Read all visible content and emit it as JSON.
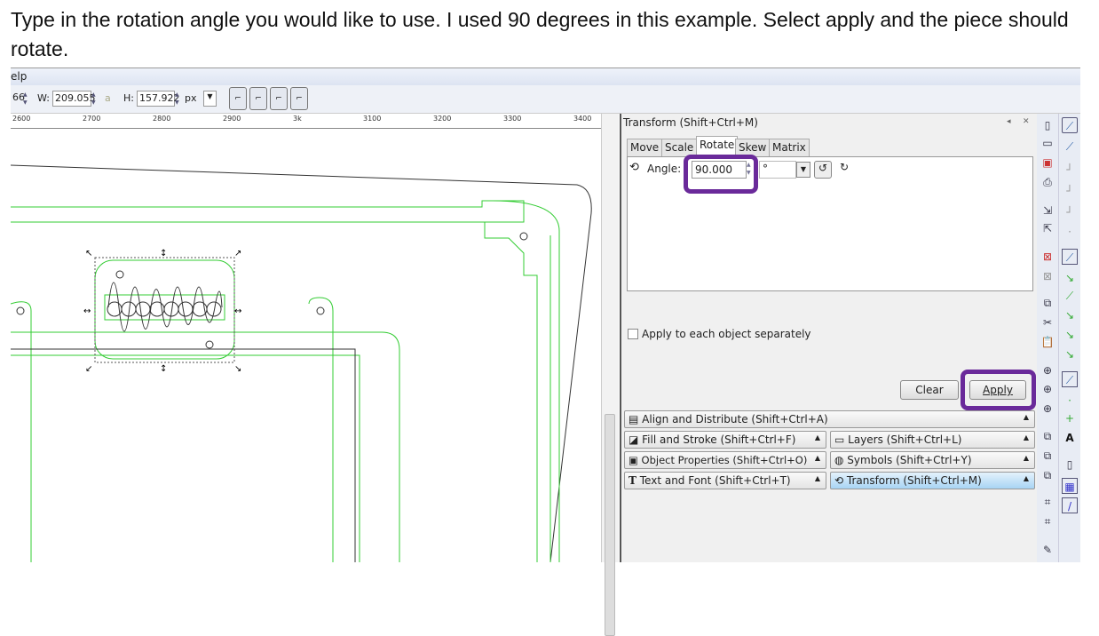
{
  "caption": "Type in the rotation angle you would like to use. I used 90 degrees in this example. Select apply and the piece should rotate.",
  "menubar": {
    "visible_item": "elp"
  },
  "toolbar": {
    "y_value": "66",
    "w_label": "W:",
    "w_value": "209.055",
    "h_label": "H:",
    "h_value": "157.922",
    "unit": "px"
  },
  "ruler": {
    "ticks": [
      "2600",
      "2700",
      "2800",
      "2900",
      "3k",
      "3100",
      "3200",
      "3300",
      "3400"
    ]
  },
  "transform": {
    "title": "Transform (Shift+Ctrl+M)",
    "tabs": [
      "Move",
      "Scale",
      "Rotate",
      "Skew",
      "Matrix"
    ],
    "active_tab": "Rotate",
    "angle_label": "Angle:",
    "angle_value": "90.000",
    "angle_unit": "°",
    "apply_each_label": "Apply to each object separately",
    "apply_each_checked": false,
    "clear_label": "Clear",
    "apply_label": "Apply"
  },
  "docks": {
    "align": "Align and Distribute (Shift+Ctrl+A)",
    "fill": "Fill and Stroke (Shift+Ctrl+F)",
    "layers": "Layers (Shift+Ctrl+L)",
    "object": "Object Properties (Shift+Ctrl+O)",
    "symbols": "Symbols (Shift+Ctrl+Y)",
    "text": "Text and Font (Shift+Ctrl+T)",
    "transform": "Transform (Shift+Ctrl+M)"
  },
  "colors": {
    "highlight": "#6a2a9a",
    "guide_green": "#33cc33",
    "active_dock": "#a8d4f4"
  }
}
